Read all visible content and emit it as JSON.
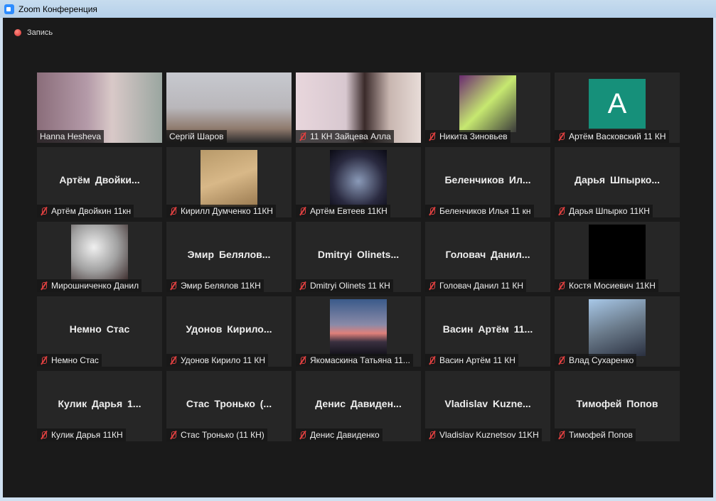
{
  "window": {
    "title": "Zoom Конференция"
  },
  "recording": {
    "label": "Запись"
  },
  "participants": [
    {
      "name": "Hanna Hesheva",
      "muted": false,
      "type": "video",
      "bg": "linear-gradient(90deg,#8a6d7a 0%,#b49aa8 40%,#d9c9c8 60%,#9aa6a0 100%)"
    },
    {
      "name": "Сергій Шаров",
      "muted": false,
      "type": "video",
      "active": true,
      "bg": "linear-gradient(180deg,#c7c9cf 0%,#b9b7bb 50%,#8f7a6d 80%,#2a2a2a 100%)"
    },
    {
      "name": "11 КН Зайцева Алла",
      "muted": true,
      "type": "video",
      "bg": "linear-gradient(90deg,#e8d6dc 0%,#d8c8d0 40%,#3a2a2a 55%,#c8b6b0 75%,#e8dcd8 100%)"
    },
    {
      "name": "Никита Зиновьев",
      "muted": true,
      "type": "avatar",
      "bg": "linear-gradient(135deg,#6a2a70,#c6e870,#3a3a3a)"
    },
    {
      "name": "Артём Васковский 11 КН",
      "muted": true,
      "type": "letter",
      "letter": "A"
    },
    {
      "name": "Артём Двойкин 11кн",
      "display": "Артём Двойки...",
      "muted": true,
      "type": "text"
    },
    {
      "name": "Кирилл Думченко 11КН",
      "muted": true,
      "type": "avatar",
      "bg": "linear-gradient(160deg,#b89a6a,#d8b888,#9a7a50)"
    },
    {
      "name": "Артём Евтеев 11КН",
      "muted": true,
      "type": "avatar",
      "bg": "radial-gradient(circle at 50% 55%,#8a9ab8,#2a2a40 60%,#0a0a14)"
    },
    {
      "name": "Беленчиков Илья 11 кн",
      "display": "Беленчиков Ил...",
      "muted": true,
      "type": "text"
    },
    {
      "name": "Дарья Шпырко 11КН",
      "display": "Дарья Шпырко...",
      "muted": true,
      "type": "text"
    },
    {
      "name": "Мирошниченко Данил",
      "muted": true,
      "type": "avatar",
      "bg": "radial-gradient(circle at 40% 40%,#f0f0f0,#a0a0a0 50%,#3a2a2a)"
    },
    {
      "name": "Эмир Белялов 11КН",
      "display": "Эмир Белялов...",
      "muted": true,
      "type": "text"
    },
    {
      "name": "Dmitryi Olinets 11 КН",
      "display": "Dmitryi Olinets...",
      "muted": true,
      "type": "text"
    },
    {
      "name": "Головач Данил 11 КН",
      "display": "Головач Данил...",
      "muted": true,
      "type": "text"
    },
    {
      "name": "Костя Мосиевич 11КН",
      "muted": true,
      "type": "avatar",
      "bg": "#000000"
    },
    {
      "name": "Немно Стас",
      "display": "Немно Стас",
      "muted": true,
      "type": "text"
    },
    {
      "name": "Удонов Кирило 11 КН",
      "display": "Удонов Кирило...",
      "muted": true,
      "type": "text"
    },
    {
      "name": "Якомаскина Татьяна 11...",
      "muted": true,
      "type": "avatar",
      "bg": "linear-gradient(180deg,#3a5a8a 0%,#8a8aa8 45%,#e0807a 60%,#3a3040 75%,#101018 100%)"
    },
    {
      "name": "Васин Артём 11 КН",
      "display": "Васин Артём 11...",
      "muted": true,
      "type": "text"
    },
    {
      "name": "Влад Сухаренко",
      "muted": true,
      "type": "avatar",
      "bg": "linear-gradient(160deg,#a8c8e8,#6a7a8a 50%,#2a3040)"
    },
    {
      "name": "Кулик Дарья 11КН",
      "display": "Кулик Дарья 1...",
      "muted": true,
      "type": "text"
    },
    {
      "name": "Стас Тронько (11 КН)",
      "display": "Стас Тронько (...",
      "muted": true,
      "type": "text"
    },
    {
      "name": "Денис Давиденко",
      "display": "Денис Давиден...",
      "muted": true,
      "type": "text"
    },
    {
      "name": "Vladislav Kuznetsov 11KH",
      "display": "Vladislav Kuzne...",
      "muted": true,
      "type": "text"
    },
    {
      "name": "Тимофей Попов",
      "display": "Тимофей Попов",
      "muted": true,
      "type": "text"
    }
  ]
}
